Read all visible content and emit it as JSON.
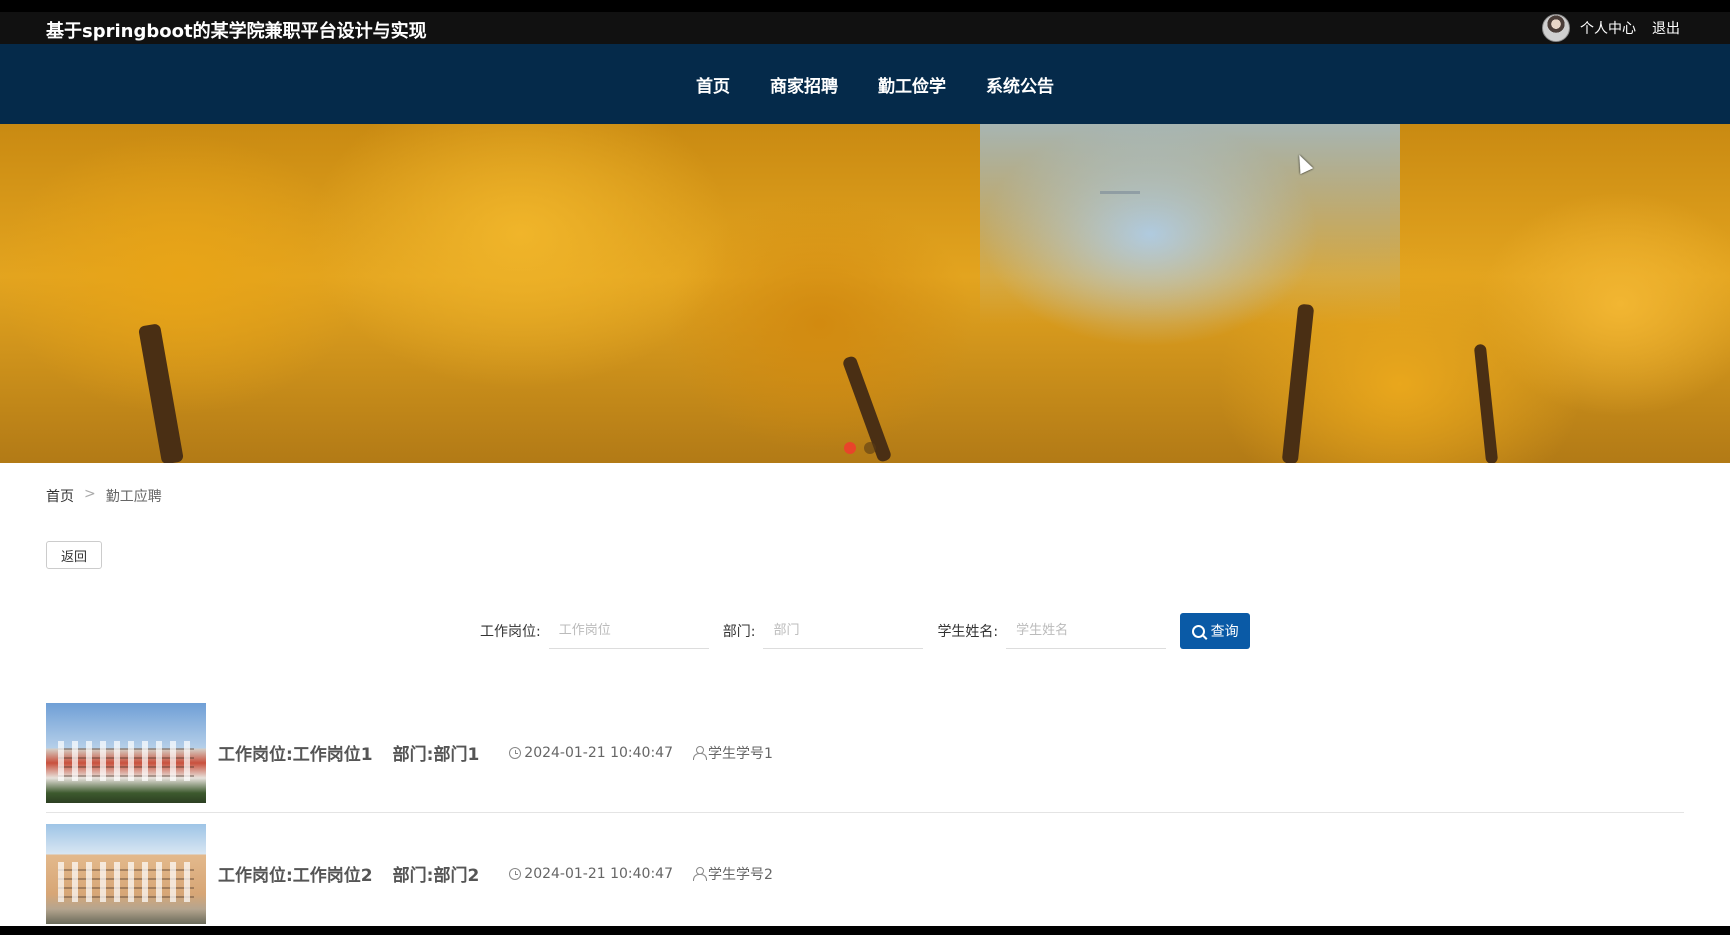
{
  "header": {
    "site_title": "基于springboot的某学院兼职平台设计与实现",
    "user_center": "个人中心",
    "logout": "退出"
  },
  "nav": {
    "items": [
      {
        "label": "首页"
      },
      {
        "label": "商家招聘"
      },
      {
        "label": "勤工俭学"
      },
      {
        "label": "系统公告"
      }
    ]
  },
  "banner": {
    "slide_count": 3,
    "active_slide": 2
  },
  "breadcrumb": {
    "home": "首页",
    "separator": ">",
    "current": "勤工应聘"
  },
  "back_button": "返回",
  "search": {
    "fields": [
      {
        "label": "工作岗位:",
        "placeholder": "工作岗位",
        "value": ""
      },
      {
        "label": "部门:",
        "placeholder": "部门",
        "value": ""
      },
      {
        "label": "学生姓名:",
        "placeholder": "学生姓名",
        "value": ""
      }
    ],
    "button_label": "查询"
  },
  "jobs": [
    {
      "title": "工作岗位:工作岗位1",
      "dept": "部门:部门1",
      "datetime": "2024-01-21 10:40:47",
      "student": "学生学号1"
    },
    {
      "title": "工作岗位:工作岗位2",
      "dept": "部门:部门2",
      "datetime": "2024-01-21 10:40:47",
      "student": "学生学号2"
    }
  ],
  "colors": {
    "topbar_bg": "#111111",
    "nav_bg": "#052a4a",
    "query_button": "#0a5aa6",
    "active_dot": "#e8442a"
  }
}
